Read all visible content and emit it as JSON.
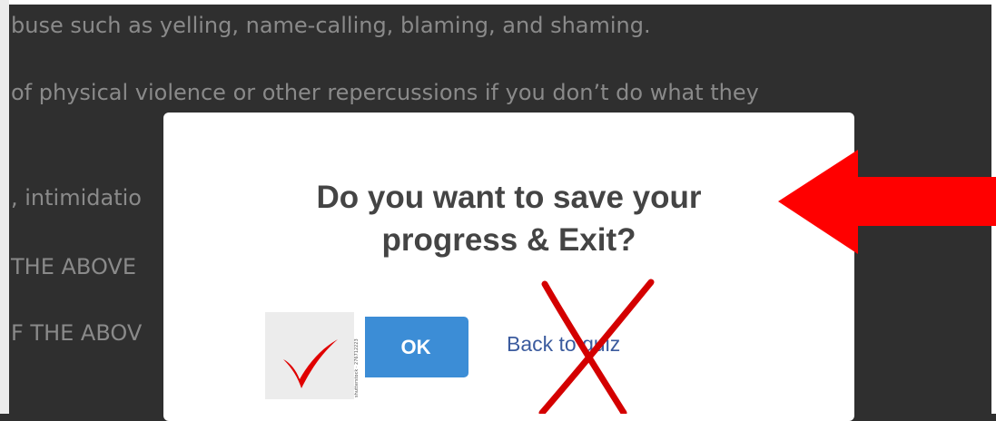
{
  "background_text": {
    "line1": "buse such as yelling, name-calling, blaming, and shaming.",
    "line2": "of physical violence or other repercussions if you don’t do what they",
    "line3": ", intimidatio",
    "line4": "THE ABOVE",
    "line5": "F THE ABOV"
  },
  "dialog": {
    "title_line1": "Do you want to save your",
    "title_line2": "progress & Exit?",
    "ok_label": "OK",
    "back_label": "Back to quiz"
  },
  "annotations": {
    "stock_watermark": "shutterstock · 276712223",
    "arrow_color": "#ff0000",
    "check_color": "#e00000",
    "cross_color": "#d40000"
  }
}
